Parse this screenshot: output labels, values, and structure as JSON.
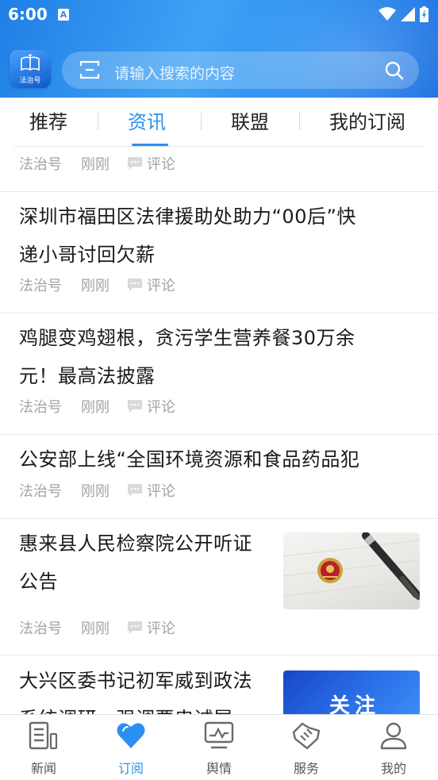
{
  "status_bar": {
    "time": "6:00",
    "notification_badge": "A"
  },
  "header": {
    "logo_text": "法治号",
    "search_placeholder": "请输入搜索的内容"
  },
  "tabs": [
    {
      "label": "推荐",
      "active": false
    },
    {
      "label": "资讯",
      "active": true
    },
    {
      "label": "联盟",
      "active": false
    },
    {
      "label": "我的订阅",
      "active": false
    }
  ],
  "feed": [
    {
      "title": "",
      "source": "法治号",
      "time": "刚刚",
      "comment_label": "评论"
    },
    {
      "title_line1": "深圳市福田区法律援助处助力“00后”快",
      "title_line2": "递小哥讨回欠薪",
      "source": "法治号",
      "time": "刚刚",
      "comment_label": "评论"
    },
    {
      "title_line1": "鸡腿变鸡翅根，贪污学生营养餐30万余",
      "title_line2": "元！最高法披露",
      "source": "法治号",
      "time": "刚刚",
      "comment_label": "评论"
    },
    {
      "title_line1": "公安部上线“全国环境资源和食品药品犯",
      "source": "法治号",
      "time": "刚刚",
      "comment_label": "评论"
    },
    {
      "title_line1": "惠来县人民检察院公开听证",
      "title_line2": "公告",
      "source": "法治号",
      "time": "刚刚",
      "comment_label": "评论",
      "thumbnail": "badge-and-pen-photo"
    },
    {
      "title_line1": "大兴区委书记初军威到政法",
      "title_line2": "系统调研，强调要忠诚履",
      "thumbnail_text": "关注"
    }
  ],
  "bottom_nav": [
    {
      "label": "新闻",
      "icon": "news-icon",
      "active": false
    },
    {
      "label": "订阅",
      "icon": "heart-icon",
      "active": true
    },
    {
      "label": "舆情",
      "icon": "monitor-icon",
      "active": false
    },
    {
      "label": "服务",
      "icon": "handshake-icon",
      "active": false
    },
    {
      "label": "我的",
      "icon": "user-icon",
      "active": false
    }
  ],
  "colors": {
    "accent": "#2b8ff0",
    "header_start": "#1f7fe6",
    "meta_text": "#a3a3a3"
  }
}
